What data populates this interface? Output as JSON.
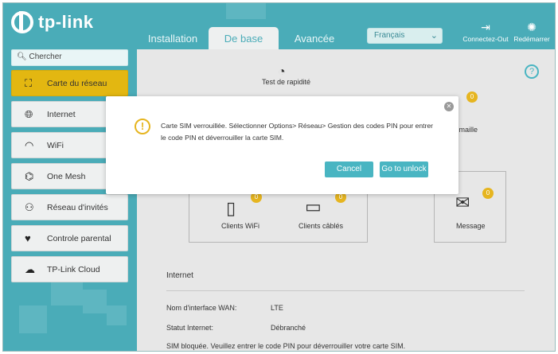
{
  "brand": {
    "logo_text": "tp-link"
  },
  "tabs": [
    {
      "label": "Installation rapide"
    },
    {
      "label": "De base"
    },
    {
      "label": "Avancée"
    }
  ],
  "language": {
    "selected": "Français"
  },
  "header_buttons": {
    "logout": "Connectez-Out",
    "reboot": "Redémarrer"
  },
  "search": {
    "placeholder": "Chercher"
  },
  "sidebar": {
    "items": [
      {
        "label": "Carte du réseau"
      },
      {
        "label": "Internet"
      },
      {
        "label": "WiFi"
      },
      {
        "label": "One Mesh"
      },
      {
        "label": "Réseau d'invités"
      },
      {
        "label": "Controle parental"
      },
      {
        "label": "TP-Link Cloud"
      }
    ]
  },
  "map": {
    "speed_test": "Test de rapidité",
    "mesh_fragment": "e maille",
    "clients_wifi": "Clients WiFi",
    "clients_wired": "Clients câblés",
    "message": "Message",
    "badge_count": "0"
  },
  "internet": {
    "section_title": "Internet",
    "wan_label": "Nom d'interface WAN:",
    "wan_value": "LTE",
    "status_label": "Statut Internet:",
    "status_value": "Débranché",
    "sim_note": "SIM bloquée. Veuillez entrer le code PIN pour déverrouiller votre carte SIM."
  },
  "modal": {
    "message": "Carte SIM verrouillée. Sélectionner Options> Réseau> Gestion des codes PIN pour entrer le code PIN et déverrouiller la carte SIM.",
    "cancel": "Cancel",
    "unlock": "Go to unlock"
  },
  "colors": {
    "accent": "#4aacb8",
    "selected": "#e3b711",
    "button": "#49b5c2"
  }
}
